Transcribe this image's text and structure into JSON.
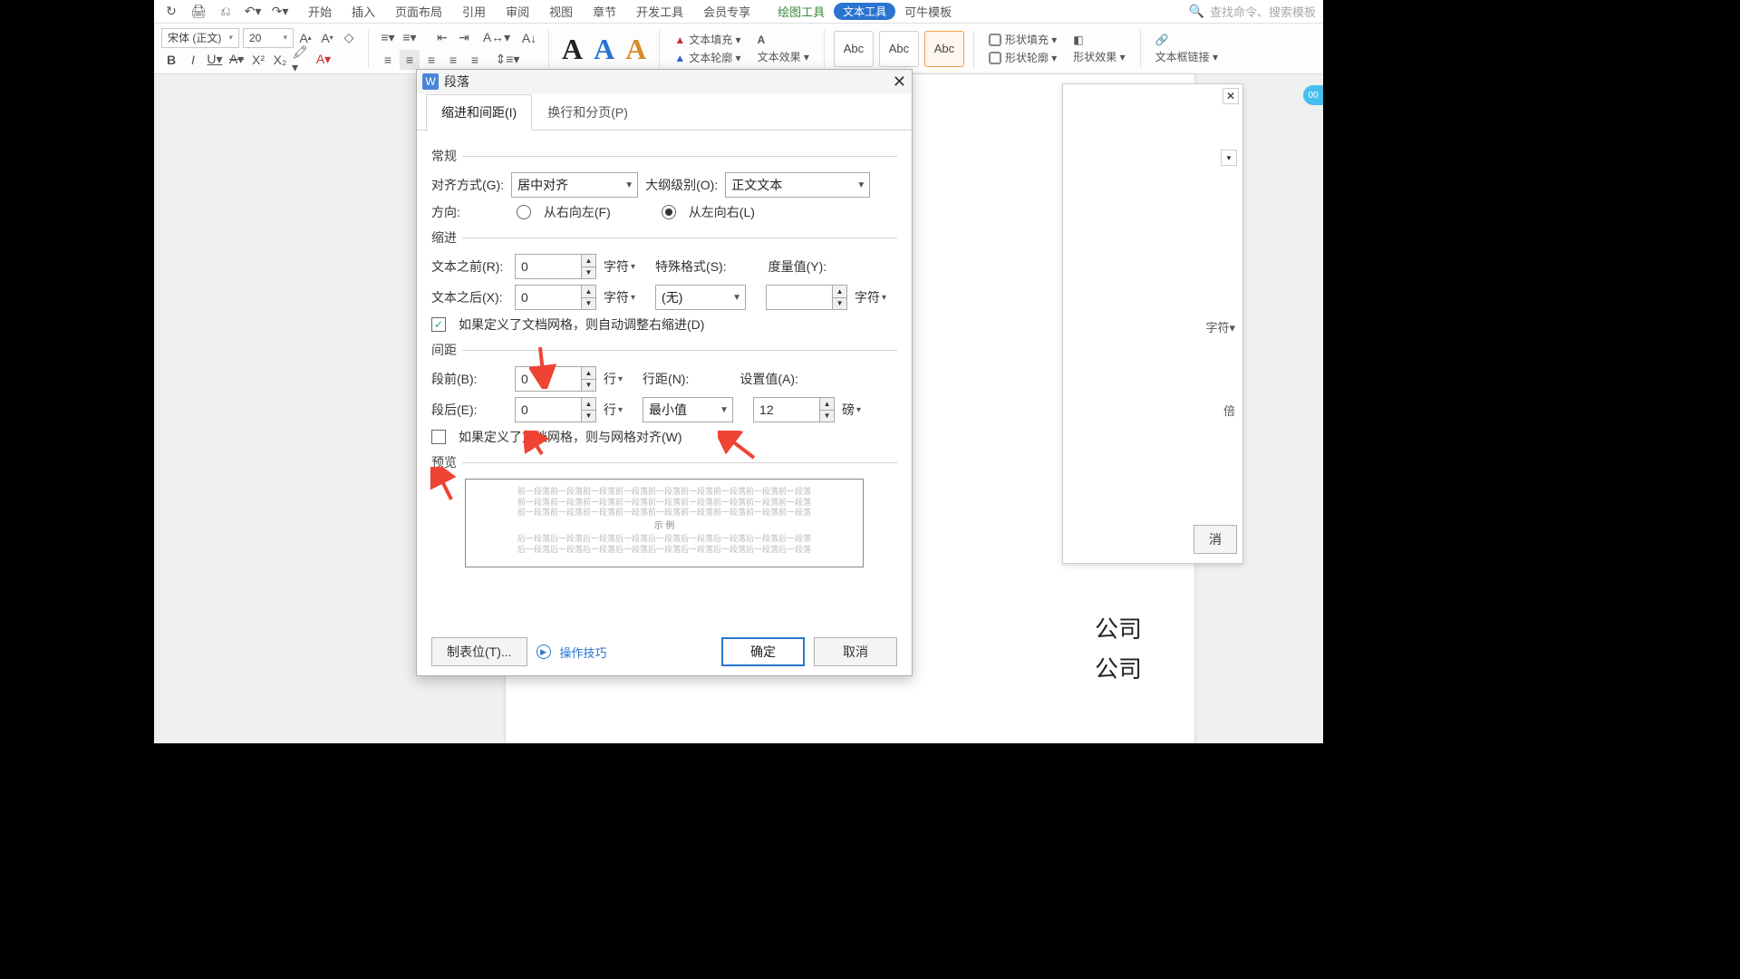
{
  "menubar": {
    "qat": [
      "↻",
      "🖨",
      "⎌",
      "↶",
      "↷"
    ],
    "tabs": [
      "开始",
      "插入",
      "页面布局",
      "引用",
      "审阅",
      "视图",
      "章节",
      "开发工具",
      "会员专享"
    ],
    "ctx_draw": "绘图工具",
    "ctx_text": "文本工具",
    "templates": "可牛模板",
    "search_hint": "查找命令、搜索模板"
  },
  "ribbon": {
    "font": "宋体 (正文)",
    "size": "20",
    "abc": [
      "Abc",
      "Abc",
      "Abc"
    ],
    "text_fill": "文本填充 ▾",
    "text_outline": "文本轮廓 ▾",
    "text_effect": "文本效果 ▾",
    "shape_fill": "形状填充 ▾",
    "shape_outline": "形状轮廓 ▾",
    "shape_effect": "形状效果 ▾",
    "frame_link": "文本框链接 ▾"
  },
  "dialog": {
    "title": "段落",
    "tabs": {
      "indent": "缩进和间距(I)",
      "break": "换行和分页(P)"
    },
    "sect_general": "常规",
    "align_label": "对齐方式(G):",
    "align_value": "居中对齐",
    "outline_label": "大纲级别(O):",
    "outline_value": "正文文本",
    "direction_label": "方向:",
    "rtl": "从右向左(F)",
    "ltr": "从左向右(L)",
    "sect_indent": "缩进",
    "before_text": "文本之前(R):",
    "after_text": "文本之后(X):",
    "special_label": "特殊格式(S):",
    "special_value": "(无)",
    "measure_label": "度量值(Y):",
    "unit_char": "字符",
    "auto_adjust": "如果定义了文档网格，则自动调整右缩进(D)",
    "sect_spacing": "间距",
    "before_para": "段前(B):",
    "after_para": "段后(E):",
    "line_spacing_label": "行距(N):",
    "line_spacing_value": "最小值",
    "setat_label": "设置值(A):",
    "setat_value": "12",
    "unit_line": "行",
    "unit_pt": "磅",
    "snap_grid": "如果定义了文档网格，则与网格对齐(W)",
    "sect_preview": "预览",
    "zero": "0",
    "tabstops": "制表位(T)...",
    "tips": "操作技巧",
    "ok": "确定",
    "cancel": "取消",
    "preview_prev": "前一段落前一段落前一段落前一段落前一段落前一段落前一段落前一段落前一段落",
    "preview_cur": "示 例",
    "preview_next": "后一段落后一段落后一段落后一段落后一段落后一段落后一段落后一段落后一段落"
  },
  "behind": {
    "cancel": "消",
    "unit": "字符",
    "mult": "倍"
  },
  "page": {
    "company1": "公司",
    "company2": "公司"
  },
  "badge": "00"
}
